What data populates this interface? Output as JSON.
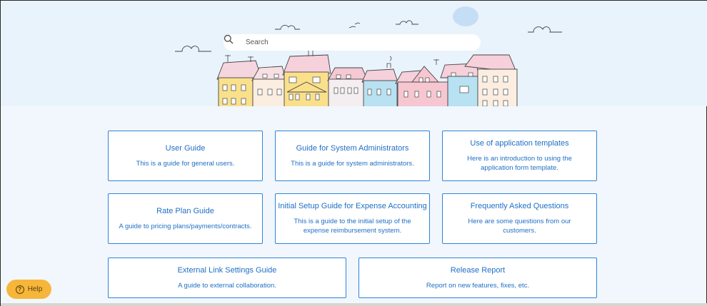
{
  "search": {
    "placeholder": "Search"
  },
  "cards": [
    {
      "title": "User Guide",
      "description": "This is a guide for general users."
    },
    {
      "title": "Guide for System Administrators",
      "description": "This is a guide for system administrators."
    },
    {
      "title": "Use of application templates",
      "description": "Here is an introduction to using the application form template."
    },
    {
      "title": "Rate Plan Guide",
      "description": "A guide to pricing plans/payments/contracts."
    },
    {
      "title": "Initial Setup Guide for Expense Accounting",
      "description": "This is a guide to the initial setup of the expense reimbursement system."
    },
    {
      "title": "Frequently Asked Questions",
      "description": "Here are some questions from our customers."
    },
    {
      "title": "External Link Settings Guide",
      "description": "A guide to external collaboration."
    },
    {
      "title": "Release Report",
      "description": "Report on new features, fixes, etc."
    }
  ],
  "help": {
    "label": "Help",
    "icon": "question-icon"
  },
  "colors": {
    "card_border": "#2f84d8",
    "card_text": "#1f6fc5",
    "help_bg": "#f6b63a",
    "hero_bg": "#e9f3fc"
  }
}
